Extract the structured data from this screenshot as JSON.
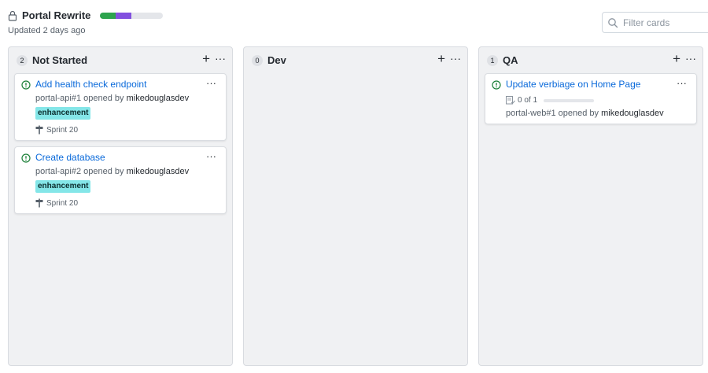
{
  "project": {
    "title": "Portal Rewrite",
    "updated": "Updated 2 days ago",
    "progress": [
      {
        "color": "#2da44e",
        "fraction": 0.25
      },
      {
        "color": "#8250df",
        "fraction": 0.25
      }
    ]
  },
  "filter": {
    "placeholder": "Filter cards",
    "icon": "search-icon"
  },
  "columns": [
    {
      "name": "Not Started",
      "count": "2",
      "cards": [
        {
          "title": "Add health check endpoint",
          "ref": "portal-api#1",
          "opened_by": " opened by ",
          "user": "mikedouglasdev",
          "label": "enhancement",
          "milestone": "Sprint 20"
        },
        {
          "title": "Create database",
          "ref": "portal-api#2",
          "opened_by": " opened by ",
          "user": "mikedouglasdev",
          "label": "enhancement",
          "milestone": "Sprint 20"
        }
      ]
    },
    {
      "name": "Dev",
      "count": "0",
      "cards": []
    },
    {
      "name": "QA",
      "count": "1",
      "cards": [
        {
          "title": "Update verbiage on Home Page",
          "tasks": "0 of 1",
          "tasks_done_fraction": 0,
          "ref": "portal-web#1",
          "opened_by": " opened by ",
          "user": "mikedouglasdev"
        }
      ]
    }
  ],
  "colors": {
    "link": "#0969da",
    "label_bg": "#84e6e8",
    "open_issue": "#1a7f37"
  }
}
